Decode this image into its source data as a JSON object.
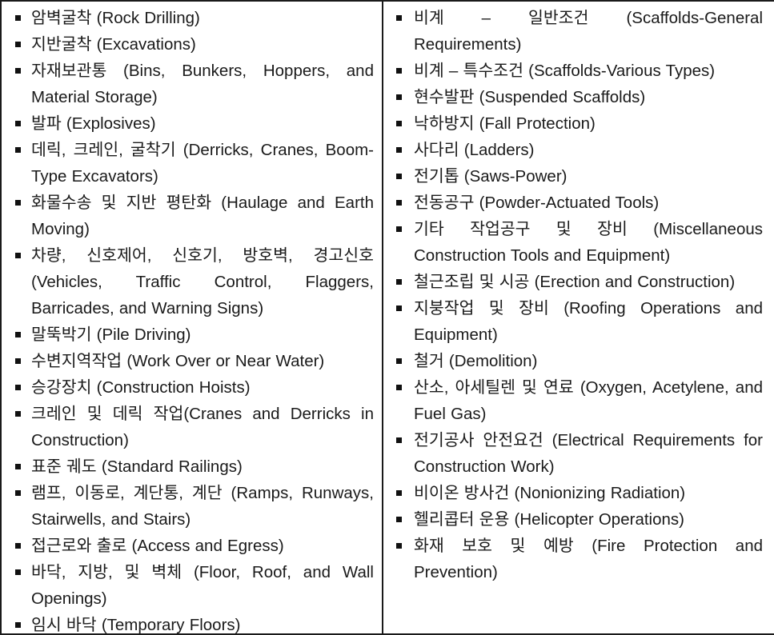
{
  "document": {
    "type": "two-column-list-table",
    "bullet_glyph": "square-bullet",
    "text_color": "#1a1a1a",
    "border_color": "#1a1a1a"
  },
  "columns": {
    "left": {
      "items": [
        "암벽굴착 (Rock Drilling)",
        "지반굴착 (Excavations)",
        "자재보관통 (Bins, Bunkers, Hoppers, and Material Storage)",
        "발파 (Explosives)",
        "데릭, 크레인, 굴착기 (Derricks, Cranes, Boom-Type Excavators)",
        "화물수송 및 지반 평탄화 (Haulage and Earth Moving)",
        "차량, 신호제어, 신호기, 방호벽, 경고신호 (Vehicles, Traffic Control, Flaggers, Barricades, and Warning Signs)",
        "말뚝박기 (Pile Driving)",
        "수변지역작업 (Work Over or Near  Water)",
        "승강장치 (Construction Hoists)",
        "크레인 및 데릭 작업(Cranes and Derricks in Construction)",
        "표준 궤도 (Standard Railings)",
        "램프, 이동로, 계단통, 계단 (Ramps, Runways, Stairwells, and Stairs)",
        "접근로와 출로 (Access and Egress)",
        "바닥, 지방, 및 벽체 (Floor, Roof, and Wall Openings)",
        "임시 바닥 (Temporary Floors)"
      ]
    },
    "right": {
      "items": [
        "비계 – 일반조건 (Scaffolds-General Requirements)",
        "비계 – 특수조건 (Scaffolds-Various Types)",
        "현수발판 (Suspended Scaffolds)",
        "낙하방지 (Fall Protection)",
        "사다리 (Ladders)",
        "전기톱 (Saws-Power)",
        "전동공구 (Powder-Actuated Tools)",
        "기타 작업공구 및 장비 (Miscellaneous Construction Tools and  Equipment)",
        "철근조립 및 시공 (Erection and Construction)",
        "지붕작업 및 장비 (Roofing Operations and Equipment)",
        "철거 (Demolition)",
        "산소, 아세틸렌 및 연료 (Oxygen, Acetylene, and Fuel Gas)",
        "전기공사 안전요건 (Electrical Requirements for Construction  Work)",
        "비이온 방사건 (Nonionizing Radiation)",
        "헬리콥터 운용 (Helicopter Operations)",
        "화재 보호 및 예방 (Fire Protection and Prevention)"
      ]
    }
  }
}
